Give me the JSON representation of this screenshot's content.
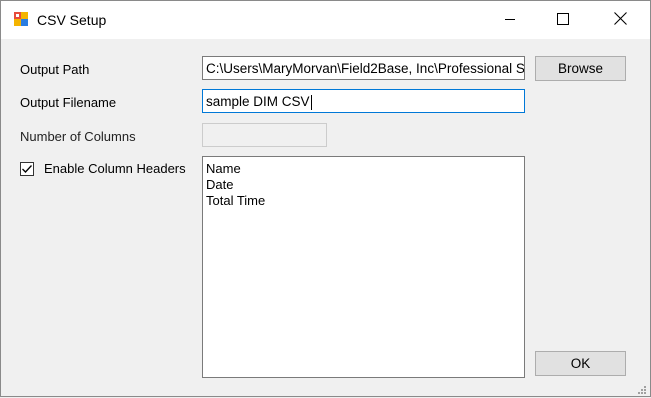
{
  "window": {
    "title": "CSV Setup",
    "icons": {
      "app": "app-icon",
      "minimize": "minimize-icon",
      "maximize": "maximize-icon",
      "close": "close-icon"
    }
  },
  "form": {
    "output_path_label": "Output Path",
    "output_path_value": "C:\\Users\\MaryMorvan\\Field2Base, Inc\\Professional S",
    "output_filename_label": "Output Filename",
    "output_filename_value": "sample DIM CSV",
    "number_of_columns_label": "Number of Columns",
    "number_of_columns_value": "",
    "enable_headers_label": "Enable Column Headers",
    "enable_headers_checked": true,
    "headers": [
      "Name",
      "Date",
      "Total Time"
    ]
  },
  "buttons": {
    "browse": "Browse",
    "ok": "OK"
  },
  "colors": {
    "focus_border": "#0078d7",
    "button_face": "#e1e1e1",
    "dialog_bg": "#f0f0f0"
  }
}
